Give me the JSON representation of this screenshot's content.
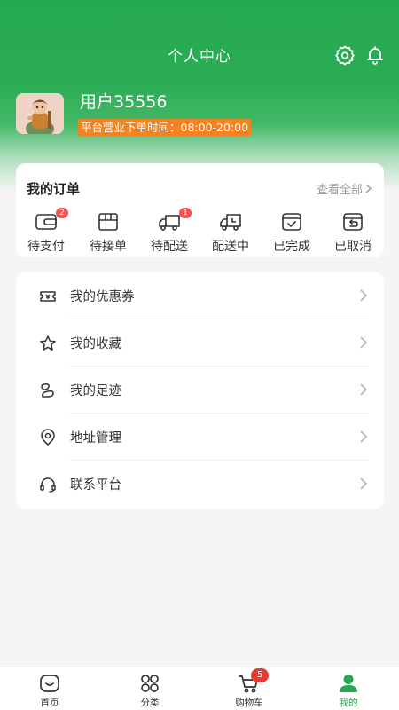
{
  "header": {
    "title": "个人中心",
    "settings_icon": "gear-icon",
    "bell_icon": "bell-icon"
  },
  "profile": {
    "username": "用户35556",
    "business_hours": "平台营业下单时间：08:00-20:00",
    "badge_color": "#f58220"
  },
  "orders": {
    "title": "我的订单",
    "view_all": "查看全部",
    "items": [
      {
        "label": "待支付",
        "icon": "wallet-icon",
        "badge": "2"
      },
      {
        "label": "待接单",
        "icon": "package-icon",
        "badge": ""
      },
      {
        "label": "待配送",
        "icon": "truck-icon",
        "badge": "1"
      },
      {
        "label": "配送中",
        "icon": "delivery-truck-icon",
        "badge": ""
      },
      {
        "label": "已完成",
        "icon": "completed-box-icon",
        "badge": ""
      },
      {
        "label": "已取消",
        "icon": "cancelled-box-icon",
        "badge": ""
      }
    ]
  },
  "menu": [
    {
      "label": "我的优惠券",
      "icon": "coupon-icon"
    },
    {
      "label": "我的收藏",
      "icon": "star-icon"
    },
    {
      "label": "我的足迹",
      "icon": "footprint-icon"
    },
    {
      "label": "地址管理",
      "icon": "location-pin-icon"
    },
    {
      "label": "联系平台",
      "icon": "headset-icon"
    }
  ],
  "tabbar": [
    {
      "label": "首页",
      "icon": "home-icon",
      "active": false
    },
    {
      "label": "分类",
      "icon": "category-icon",
      "active": false
    },
    {
      "label": "购物车",
      "icon": "cart-icon",
      "active": false,
      "badge": "5"
    },
    {
      "label": "我的",
      "icon": "user-icon",
      "active": true
    }
  ],
  "colors": {
    "brand_green": "#2aa653",
    "badge_red": "#f05454",
    "accent_orange": "#f58220"
  }
}
